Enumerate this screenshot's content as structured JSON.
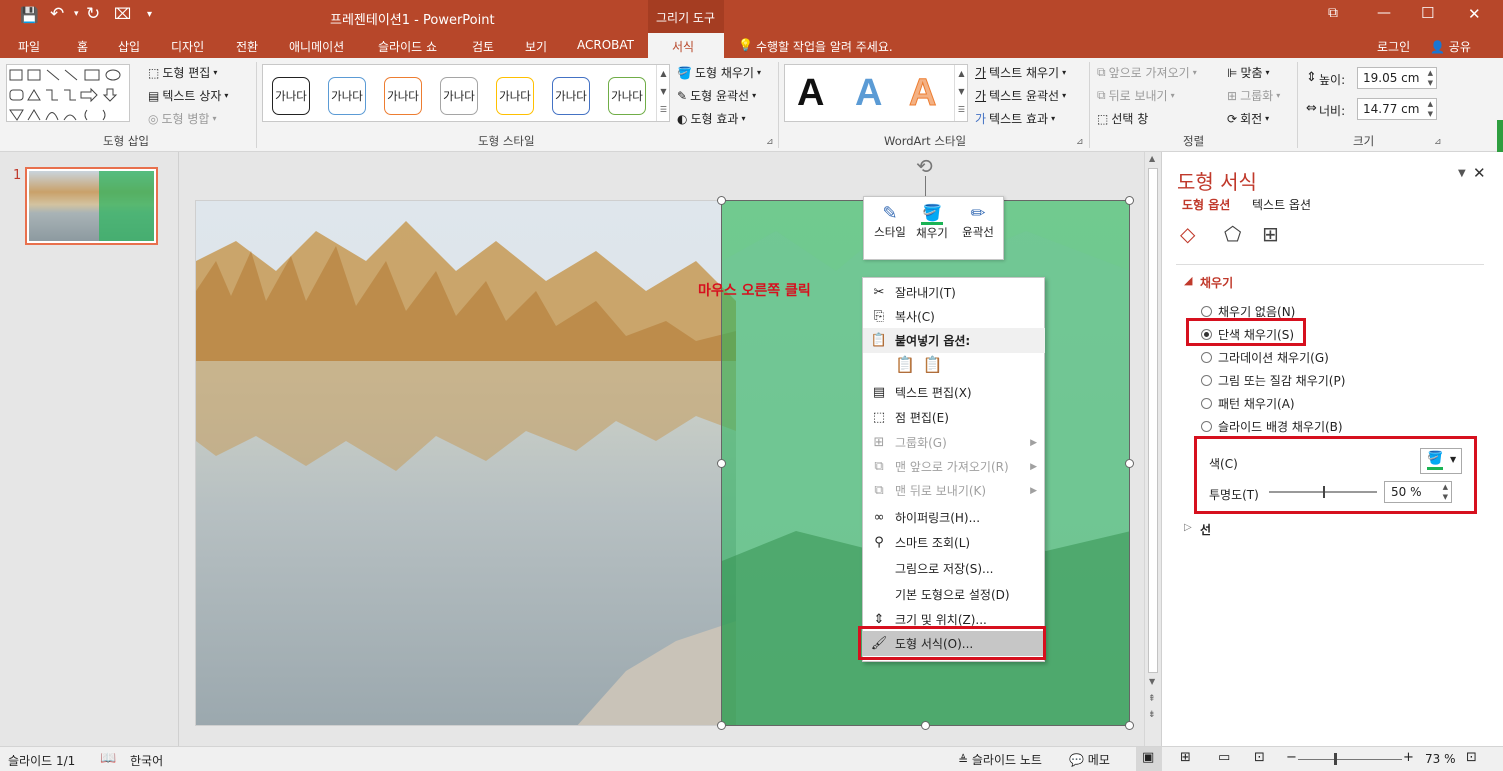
{
  "window": {
    "title": "프레젠테이션1 - PowerPoint",
    "context_tab": "그리기 도구",
    "controls": {
      "restore": "⧉",
      "minimize": "—",
      "maximize": "☐",
      "close": "✕"
    }
  },
  "tabs": [
    "파일",
    "홈",
    "삽입",
    "디자인",
    "전환",
    "애니메이션",
    "슬라이드 쇼",
    "검토",
    "보기",
    "ACROBAT",
    "서식"
  ],
  "active_tab": "서식",
  "tell_me": "수행할 작업을 알려 주세요.",
  "account": {
    "login": "로그인",
    "share": "공유"
  },
  "ribbon": {
    "insert_shapes": {
      "label": "도형 삽입",
      "edit_shape": "도형 편집",
      "text_box": "텍스트 상자",
      "merge_shapes": "도형 병합"
    },
    "shape_styles": {
      "label": "도형 스타일",
      "preset_text": "가나다",
      "fill": "도형 채우기",
      "outline": "도형 윤곽선",
      "effects": "도형 효과"
    },
    "wordart": {
      "label": "WordArt 스타일",
      "letter": "A",
      "text_fill": "텍스트 채우기",
      "text_outline": "텍스트 윤곽선",
      "text_effects": "텍스트 효과"
    },
    "arrange": {
      "label": "정렬",
      "bring_forward": "앞으로 가져오기",
      "send_backward": "뒤로 보내기",
      "selection_pane": "선택 창",
      "align": "맞춤",
      "group": "그룹화",
      "rotate": "회전"
    },
    "size": {
      "label": "크기",
      "height_label": "높이:",
      "height": "19.05 cm",
      "width_label": "너비:",
      "width": "14.77 cm"
    }
  },
  "slides_panel": {
    "slide_number": "1"
  },
  "annotation": "마우스 오른쪽 클릭",
  "mini_toolbar": {
    "style": "스타일",
    "fill": "채우기",
    "outline": "윤곽선"
  },
  "context_menu": [
    {
      "label": "잘라내기(T)",
      "icon": "scissors-icon",
      "glyph": "✂",
      "enabled": true,
      "submenu": false
    },
    {
      "label": "복사(C)",
      "icon": "copy-icon",
      "glyph": "⎘",
      "enabled": true,
      "submenu": false
    },
    {
      "label": "붙여넣기 옵션:",
      "icon": "paste-icon",
      "glyph": "📋",
      "enabled": true,
      "submenu": false,
      "header": true
    },
    {
      "label": "텍스트 편집(X)",
      "icon": "text-edit-icon",
      "glyph": "▤",
      "enabled": true,
      "submenu": false
    },
    {
      "label": "점 편집(E)",
      "icon": "edit-points-icon",
      "glyph": "⬚",
      "enabled": true,
      "submenu": false
    },
    {
      "label": "그룹화(G)",
      "icon": "group-icon",
      "glyph": "⊞",
      "enabled": false,
      "submenu": true
    },
    {
      "label": "맨 앞으로 가져오기(R)",
      "icon": "bring-front-icon",
      "glyph": "⧉",
      "enabled": false,
      "submenu": true
    },
    {
      "label": "맨 뒤로 보내기(K)",
      "icon": "send-back-icon",
      "glyph": "⧉",
      "enabled": false,
      "submenu": true
    },
    {
      "label": "하이퍼링크(H)...",
      "icon": "hyperlink-icon",
      "glyph": "∞",
      "enabled": true,
      "submenu": false
    },
    {
      "label": "스마트 조회(L)",
      "icon": "smart-lookup-icon",
      "glyph": "⚲",
      "enabled": true,
      "submenu": false
    },
    {
      "label": "그림으로 저장(S)...",
      "icon": "",
      "glyph": "",
      "enabled": true,
      "submenu": false
    },
    {
      "label": "기본 도형으로 설정(D)",
      "icon": "",
      "glyph": "",
      "enabled": true,
      "submenu": false
    },
    {
      "label": "크기 및 위치(Z)...",
      "icon": "size-position-icon",
      "glyph": "⇕",
      "enabled": true,
      "submenu": false
    },
    {
      "label": "도형 서식(O)...",
      "icon": "format-shape-icon",
      "glyph": "🖌",
      "enabled": true,
      "submenu": false,
      "highlighted": true
    }
  ],
  "format_pane": {
    "title": "도형 서식",
    "tabs": [
      "도형 옵션",
      "텍스트 옵션"
    ],
    "fill_section": "채우기",
    "fill_options": [
      {
        "label": "채우기 없음(N)",
        "selected": false
      },
      {
        "label": "단색 채우기(S)",
        "selected": true
      },
      {
        "label": "그라데이션 채우기(G)",
        "selected": false
      },
      {
        "label": "그림 또는 질감 채우기(P)",
        "selected": false
      },
      {
        "label": "패턴 채우기(A)",
        "selected": false
      },
      {
        "label": "슬라이드 배경 채우기(B)",
        "selected": false
      }
    ],
    "color_label": "색(C)",
    "transparency_label": "투명도(T)",
    "transparency": 0.5,
    "transparency_value": "50 %",
    "line_section": "선",
    "fill_color": "#1bb354"
  },
  "status": {
    "slide": "슬라이드 1/1",
    "language": "한국어",
    "notes": "슬라이드 노트",
    "comments": "메모",
    "zoom": "73 %"
  },
  "colors": {
    "accent": "#b7472a",
    "green_shape": "#2fb460",
    "highlight_box": "#d6101e"
  }
}
